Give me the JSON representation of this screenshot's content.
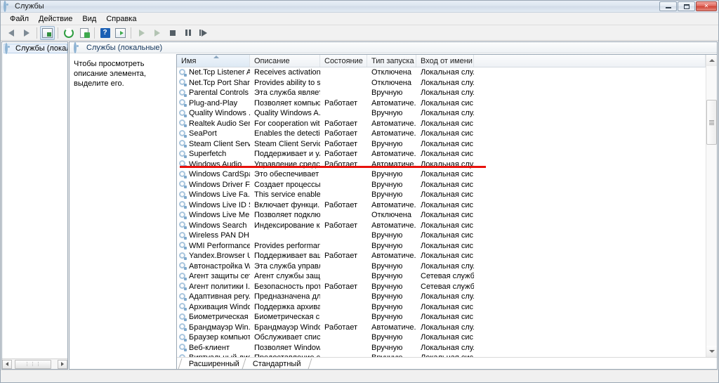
{
  "window": {
    "title": "Службы",
    "icon": "services-icon",
    "buttons": {
      "minimize": "minimize-icon",
      "maximize": "maximize-icon",
      "close": "✕"
    }
  },
  "menu": {
    "items": [
      {
        "label": "Файл",
        "name": "menu-file"
      },
      {
        "label": "Действие",
        "name": "menu-action"
      },
      {
        "label": "Вид",
        "name": "menu-view"
      },
      {
        "label": "Справка",
        "name": "menu-help"
      }
    ]
  },
  "toolbar": {
    "buttons": [
      {
        "name": "back-button",
        "icon": "arrow-left-icon"
      },
      {
        "name": "forward-button",
        "icon": "arrow-right-icon"
      },
      {
        "name": "show-hide-tree-button",
        "icon": "console-tree-icon"
      },
      {
        "name": "refresh-button",
        "icon": "refresh-icon"
      },
      {
        "name": "export-list-button",
        "icon": "export-icon"
      },
      {
        "name": "help-button",
        "icon": "help-icon"
      },
      {
        "name": "properties-button",
        "icon": "properties-icon"
      },
      {
        "name": "start-service-button",
        "icon": "play-icon"
      },
      {
        "name": "resume-service-button",
        "icon": "play-icon"
      },
      {
        "name": "stop-service-button",
        "icon": "stop-icon"
      },
      {
        "name": "pause-service-button",
        "icon": "pause-icon"
      },
      {
        "name": "restart-service-button",
        "icon": "restart-icon"
      }
    ]
  },
  "tree": {
    "root": {
      "label": "Службы (локальные)",
      "icon": "services-gear-icon"
    }
  },
  "pane": {
    "header": "Службы (локальные)",
    "header_icon": "services-gear-icon",
    "description": "Чтобы просмотреть описание элемента, выделите его."
  },
  "list": {
    "columns": [
      {
        "label": "Имя",
        "name": "column-name",
        "sorted": true
      },
      {
        "label": "Описание",
        "name": "column-description",
        "sorted": false
      },
      {
        "label": "Состояние",
        "name": "column-status",
        "sorted": false
      },
      {
        "label": "Тип запуска",
        "name": "column-startup-type",
        "sorted": false
      },
      {
        "label": "Вход от имени",
        "name": "column-log-on-as",
        "sorted": false
      }
    ],
    "rows": [
      {
        "name": "Net.Tcp Listener A...",
        "description": "Receives activation ...",
        "status": "",
        "startup": "Отключена",
        "logon": "Локальная слу..."
      },
      {
        "name": "Net.Tcp Port Shari...",
        "description": "Provides ability to s...",
        "status": "",
        "startup": "Отключена",
        "logon": "Локальная слу..."
      },
      {
        "name": "Parental Controls",
        "description": "Эта служба являет...",
        "status": "",
        "startup": "Вручную",
        "logon": "Локальная слу..."
      },
      {
        "name": "Plug-and-Play",
        "description": "Позволяет компью...",
        "status": "Работает",
        "startup": "Автоматиче...",
        "logon": "Локальная сис..."
      },
      {
        "name": "Quality Windows ...",
        "description": "Quality Windows A...",
        "status": "",
        "startup": "Вручную",
        "logon": "Локальная слу..."
      },
      {
        "name": "Realtek Audio Ser...",
        "description": "For cooperation wit...",
        "status": "Работает",
        "startup": "Автоматиче...",
        "logon": "Локальная сис..."
      },
      {
        "name": "SeaPort",
        "description": "Enables the detectio...",
        "status": "Работает",
        "startup": "Автоматиче...",
        "logon": "Локальная сис..."
      },
      {
        "name": "Steam Client Servi...",
        "description": "Steam Client Servic...",
        "status": "Работает",
        "startup": "Вручную",
        "logon": "Локальная сис..."
      },
      {
        "name": "Superfetch",
        "description": "Поддерживает и ул...",
        "status": "Работает",
        "startup": "Автоматиче...",
        "logon": "Локальная сис..."
      },
      {
        "name": "Windows Audio",
        "description": "Управление средст...",
        "status": "Работает",
        "startup": "Автоматиче...",
        "logon": "Локальная слу..."
      },
      {
        "name": "Windows CardSpa...",
        "description": "Это обеспечивает ...",
        "status": "",
        "startup": "Вручную",
        "logon": "Локальная сис..."
      },
      {
        "name": "Windows Driver F...",
        "description": "Создает процессы ...",
        "status": "",
        "startup": "Вручную",
        "logon": "Локальная сис..."
      },
      {
        "name": "Windows Live Fa...",
        "description": "This service enables...",
        "status": "",
        "startup": "Вручную",
        "logon": "Локальная сис..."
      },
      {
        "name": "Windows Live ID S...",
        "description": "Включает функци...",
        "status": "Работает",
        "startup": "Автоматиче...",
        "logon": "Локальная сис..."
      },
      {
        "name": "Windows Live Me...",
        "description": "Позволяет подклю...",
        "status": "",
        "startup": "Отключена",
        "logon": "Локальная сис..."
      },
      {
        "name": "Windows Search",
        "description": "Индексирование к...",
        "status": "Работает",
        "startup": "Автоматиче...",
        "logon": "Локальная сис..."
      },
      {
        "name": "Wireless PAN DH...",
        "description": "",
        "status": "",
        "startup": "Вручную",
        "logon": "Локальная сис..."
      },
      {
        "name": "WMI Performance...",
        "description": "Provides performan...",
        "status": "",
        "startup": "Вручную",
        "logon": "Локальная сис..."
      },
      {
        "name": "Yandex.Browser U...",
        "description": "Поддерживает ваш...",
        "status": "Работает",
        "startup": "Автоматиче...",
        "logon": "Локальная сис..."
      },
      {
        "name": "Автонастройка W...",
        "description": "Эта служба управл...",
        "status": "",
        "startup": "Вручную",
        "logon": "Локальная слу..."
      },
      {
        "name": "Агент защиты сет...",
        "description": "Агент службы защ...",
        "status": "",
        "startup": "Вручную",
        "logon": "Сетевая служба"
      },
      {
        "name": "Агент политики I...",
        "description": "Безопасность прот...",
        "status": "Работает",
        "startup": "Вручную",
        "logon": "Сетевая служба"
      },
      {
        "name": "Адаптивная регу...",
        "description": "Предназначена дл...",
        "status": "",
        "startup": "Вручную",
        "logon": "Локальная слу..."
      },
      {
        "name": "Архивация Windo...",
        "description": "Поддержка архива...",
        "status": "",
        "startup": "Вручную",
        "logon": "Локальная сис..."
      },
      {
        "name": "Биометрическая ...",
        "description": "Биометрическая с...",
        "status": "",
        "startup": "Вручную",
        "logon": "Локальная сис..."
      },
      {
        "name": "Брандмауэр Win...",
        "description": "Брандмауэр Windo...",
        "status": "Работает",
        "startup": "Автоматиче...",
        "logon": "Локальная слу..."
      },
      {
        "name": "Браузер компьют...",
        "description": "Обслуживает спис...",
        "status": "",
        "startup": "Вручную",
        "logon": "Локальная сис..."
      },
      {
        "name": "Веб-клиент",
        "description": "Позволяет Window...",
        "status": "",
        "startup": "Вручную",
        "logon": "Локальная слу..."
      },
      {
        "name": "Виртуальный диск",
        "description": "Предоставление с...",
        "status": "",
        "startup": "Вручную",
        "logon": "Локальная сис..."
      }
    ]
  },
  "tabs": [
    {
      "label": "Расширенный",
      "name": "tab-extended",
      "active": true
    },
    {
      "label": "Стандартный",
      "name": "tab-standard",
      "active": false
    }
  ],
  "annotation": {
    "color": "#e8120c",
    "name": "red-underline-annotation"
  }
}
